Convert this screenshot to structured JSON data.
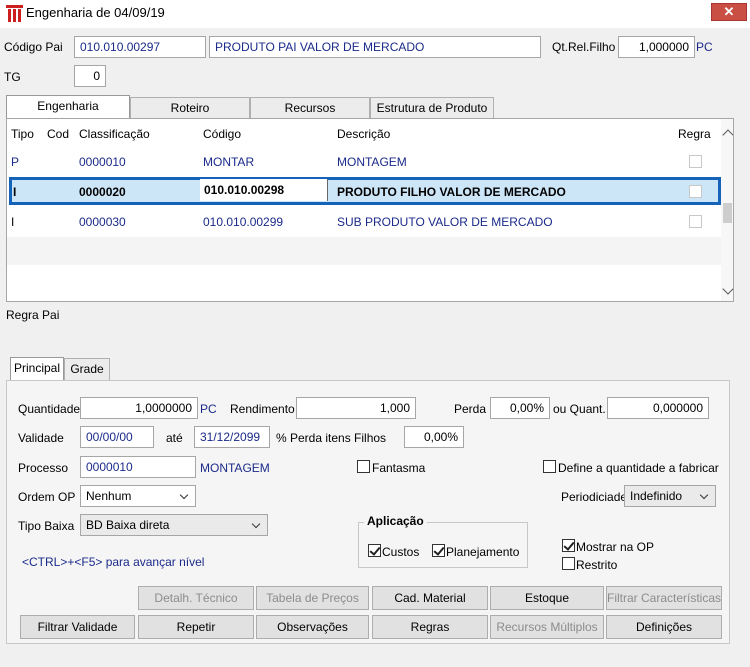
{
  "window": {
    "title": "Engenharia  de 04/09/19",
    "close": "✕"
  },
  "header": {
    "codigo_pai_label": "Código Pai",
    "codigo_pai_value": "010.010.00297",
    "descricao_value": "PRODUTO PAI VALOR DE MERCADO",
    "qt_label": "Qt.Rel.Filho",
    "qt_value": "1,000000",
    "qt_unit": "PC",
    "tg_label": "TG",
    "tg_value": "0"
  },
  "tabs_top": [
    "Engenharia",
    "Roteiro",
    "Recursos",
    "Estrutura  de Produto"
  ],
  "grid": {
    "headers": {
      "tipo": "Tipo",
      "cod": "Cod",
      "classificacao": "Classificação",
      "codigo": "Código",
      "descricao": "Descrição",
      "regra": "Regra"
    },
    "rows": [
      {
        "tipo": "P",
        "cod": "",
        "classificacao": "0000010",
        "codigo": "MONTAR",
        "descricao": "MONTAGEM",
        "regra": false
      },
      {
        "tipo": "I",
        "cod": "",
        "classificacao": "0000020",
        "codigo": "010.010.00298",
        "descricao": "PRODUTO FILHO VALOR DE MERCADO",
        "regra": false
      },
      {
        "tipo": "I",
        "cod": "",
        "classificacao": "0000030",
        "codigo": "010.010.00299",
        "descricao": "SUB PRODUTO VALOR DE MERCADO",
        "regra": false
      }
    ]
  },
  "regra_pai_label": "Regra Pai",
  "tabs_bottom": [
    "Principal",
    "Grade"
  ],
  "form": {
    "quantidade_label": "Quantidade",
    "quantidade_value": "1,0000000",
    "quantidade_unit": "PC",
    "rendimento_label": "Rendimento",
    "rendimento_value": "1,000",
    "perda_label": "Perda",
    "perda_value": "0,00%",
    "ou_quant_label": "ou Quant.",
    "ou_quant_value": "0,000000",
    "validade_label": "Validade",
    "validade_de": "00/00/00",
    "ate_label": "até",
    "validade_ate": "31/12/2099",
    "perda_filhos_label": "% Perda itens Filhos",
    "perda_filhos_value": "0,00%",
    "processo_label": "Processo",
    "processo_value": "0000010",
    "processo_desc": "MONTAGEM",
    "fantasma_label": "Fantasma",
    "define_label": "Define a quantidade a fabricar",
    "ordem_label": "Ordem OP",
    "ordem_value": "Nenhum",
    "periodicidade_label": "Periodiciade",
    "periodicidade_value": "Indefinido",
    "tipo_baixa_label": "Tipo Baixa",
    "tipo_baixa_value": "BD Baixa direta",
    "aplicacao_label": "Aplicação",
    "custos_label": "Custos",
    "planejamento_label": "Planejamento",
    "mostrar_label": "Mostrar na OP",
    "restrito_label": "Restrito",
    "hint": "<CTRL>+<F5> para avançar nível"
  },
  "buttons": {
    "detalh": "Detalh. Técnico",
    "tabela": "Tabela de Preços",
    "cad": "Cad. Material",
    "estoque": "Estoque",
    "filtrar_car": "Filtrar Características",
    "filtrar_val": "Filtrar Validade",
    "repetir": "Repetir",
    "observacoes": "Observações",
    "regras": "Regras",
    "recursos": "Recursos Múltiplos",
    "definicoes": "Definições"
  },
  "colors": {
    "accent": "#cc1f1f",
    "selection": "#1463b8",
    "selected_row": "#cde6f7"
  }
}
